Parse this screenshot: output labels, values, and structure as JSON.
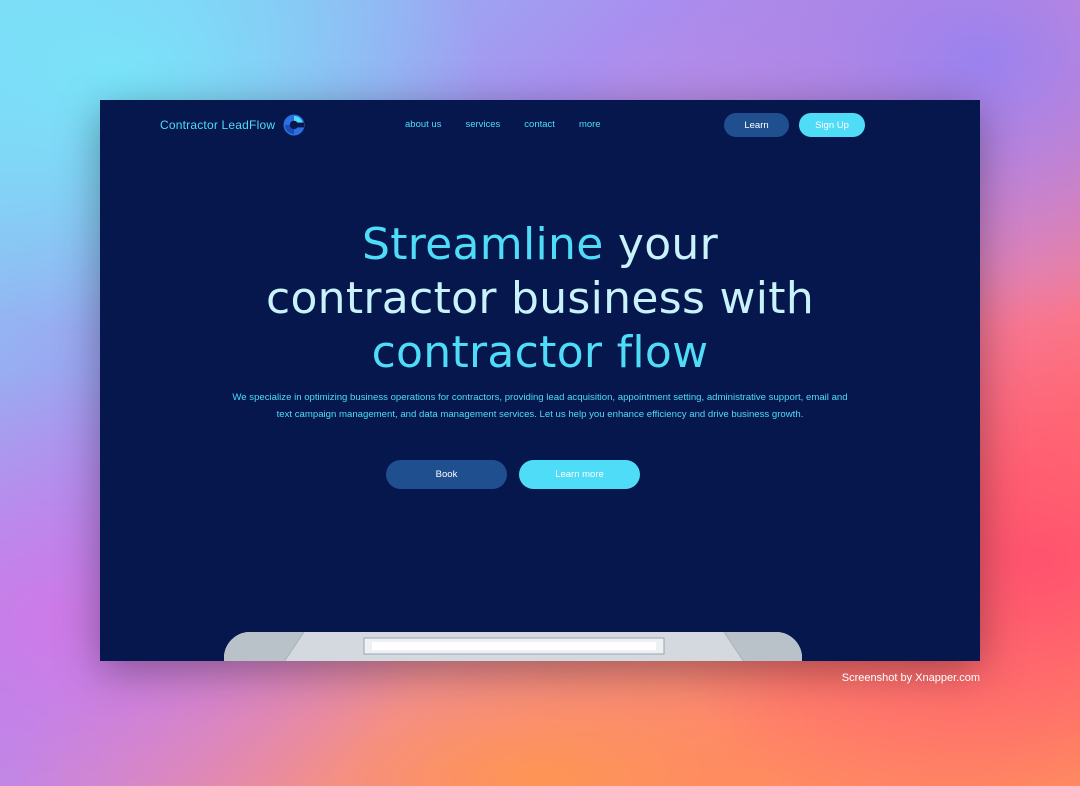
{
  "brand": {
    "name": "Contractor LeadFlow",
    "logo_icon": "contractor-leadflow-logo-icon"
  },
  "nav": {
    "links": [
      "about us",
      "services",
      "contact",
      "more"
    ],
    "learn_label": "Learn",
    "signup_label": "Sign Up"
  },
  "hero": {
    "title_line1_highlight": "Streamline",
    "title_line1_rest": "your",
    "title_line2": "contractor business with",
    "title_line3": "contractor flow",
    "description": "We specialize in optimizing business operations for contractors, providing lead acquisition, appointment setting, administrative support, email and text campaign management, and data management services. Let us help you enhance efficiency and drive business growth.",
    "book_label": "Book",
    "learn_more_label": "Learn more",
    "image_icon": "office-ceiling-photo"
  },
  "credit": "Screenshot by Xnapper.com",
  "colors": {
    "page_background": "#06174e",
    "accent": "#4fdcf7",
    "button_dark": "#1f4f8e",
    "title_light": "#c9f2fb"
  }
}
